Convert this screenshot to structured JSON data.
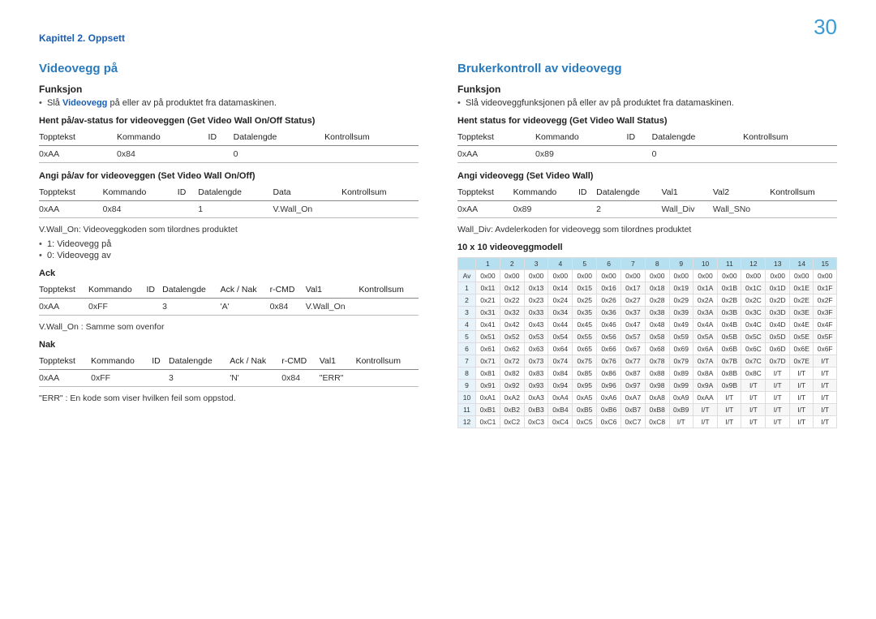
{
  "page": {
    "chapter": "Kapittel 2. Oppsett",
    "number": "30"
  },
  "left": {
    "title": "Videovegg på",
    "funksjon_label": "Funksjon",
    "funksjon_bullet_pre": "Slå ",
    "funksjon_bullet_emph": "Videovegg",
    "funksjon_bullet_post": " på eller av på produktet fra datamaskinen.",
    "section_get": "Hent på/av-status for videoveggen (Get Video Wall On/Off Status)",
    "t1": {
      "h": [
        "Topptekst",
        "Kommando",
        "ID",
        "Datalengde",
        "Kontrollsum"
      ],
      "r": [
        "0xAA",
        "0x84",
        "",
        "0",
        ""
      ]
    },
    "section_set": "Angi på/av for videoveggen (Set Video Wall On/Off)",
    "t2": {
      "h": [
        "Topptekst",
        "Kommando",
        "ID",
        "Datalengde",
        "Data",
        "Kontrollsum"
      ],
      "r": [
        "0xAA",
        "0x84",
        "",
        "1",
        "V.Wall_On",
        ""
      ]
    },
    "note1": "V.Wall_On: Videoveggkoden som tilordnes produktet",
    "note_bul1": "1: Videovegg på",
    "note_bul2": "0: Videovegg av",
    "ack_label": "Ack",
    "t3": {
      "h": [
        "Topptekst",
        "Kommando",
        "ID",
        "Datalengde",
        "Ack / Nak",
        "r-CMD",
        "Val1",
        "Kontrollsum"
      ],
      "r": [
        "0xAA",
        "0xFF",
        "",
        "3",
        "'A'",
        "0x84",
        "V.Wall_On",
        ""
      ]
    },
    "ack_note": "V.Wall_On : Samme som ovenfor",
    "nak_label": "Nak",
    "t4": {
      "h": [
        "Topptekst",
        "Kommando",
        "ID",
        "Datalengde",
        "Ack / Nak",
        "r-CMD",
        "Val1",
        "Kontrollsum"
      ],
      "r": [
        "0xAA",
        "0xFF",
        "",
        "3",
        "'N'",
        "0x84",
        "\"ERR\"",
        ""
      ]
    },
    "err_note": "\"ERR\" : En kode som viser hvilken feil som oppstod."
  },
  "right": {
    "title": "Brukerkontroll av videovegg",
    "funksjon_label": "Funksjon",
    "funksjon_bullet": "Slå videoveggfunksjonen på eller av på produktet fra datamaskinen.",
    "section_get": "Hent status for videovegg (Get Video Wall Status)",
    "t1": {
      "h": [
        "Topptekst",
        "Kommando",
        "ID",
        "Datalengde",
        "Kontrollsum"
      ],
      "r": [
        "0xAA",
        "0x89",
        "",
        "0",
        ""
      ]
    },
    "section_set": "Angi videovegg (Set Video Wall)",
    "t2": {
      "h": [
        "Topptekst",
        "Kommando",
        "ID",
        "Datalengde",
        "Val1",
        "Val2",
        "Kontrollsum"
      ],
      "r": [
        "0xAA",
        "0x89",
        "",
        "2",
        "Wall_Div",
        "Wall_SNo",
        ""
      ]
    },
    "note1": "Wall_Div: Avdelerkoden for videovegg som tilordnes produktet",
    "matrix_title": "10 x 10 videoveggmodell",
    "matrix": {
      "cols": [
        "1",
        "2",
        "3",
        "4",
        "5",
        "6",
        "7",
        "8",
        "9",
        "10",
        "11",
        "12",
        "13",
        "14",
        "15"
      ],
      "rows": [
        "Av",
        "1",
        "2",
        "3",
        "4",
        "5",
        "6",
        "7",
        "8",
        "9",
        "10",
        "11",
        "12"
      ],
      "cells": [
        [
          "0x00",
          "0x00",
          "0x00",
          "0x00",
          "0x00",
          "0x00",
          "0x00",
          "0x00",
          "0x00",
          "0x00",
          "0x00",
          "0x00",
          "0x00",
          "0x00",
          "0x00"
        ],
        [
          "0x11",
          "0x12",
          "0x13",
          "0x14",
          "0x15",
          "0x16",
          "0x17",
          "0x18",
          "0x19",
          "0x1A",
          "0x1B",
          "0x1C",
          "0x1D",
          "0x1E",
          "0x1F"
        ],
        [
          "0x21",
          "0x22",
          "0x23",
          "0x24",
          "0x25",
          "0x26",
          "0x27",
          "0x28",
          "0x29",
          "0x2A",
          "0x2B",
          "0x2C",
          "0x2D",
          "0x2E",
          "0x2F"
        ],
        [
          "0x31",
          "0x32",
          "0x33",
          "0x34",
          "0x35",
          "0x36",
          "0x37",
          "0x38",
          "0x39",
          "0x3A",
          "0x3B",
          "0x3C",
          "0x3D",
          "0x3E",
          "0x3F"
        ],
        [
          "0x41",
          "0x42",
          "0x43",
          "0x44",
          "0x45",
          "0x46",
          "0x47",
          "0x48",
          "0x49",
          "0x4A",
          "0x4B",
          "0x4C",
          "0x4D",
          "0x4E",
          "0x4F"
        ],
        [
          "0x51",
          "0x52",
          "0x53",
          "0x54",
          "0x55",
          "0x56",
          "0x57",
          "0x58",
          "0x59",
          "0x5A",
          "0x5B",
          "0x5C",
          "0x5D",
          "0x5E",
          "0x5F"
        ],
        [
          "0x61",
          "0x62",
          "0x63",
          "0x64",
          "0x65",
          "0x66",
          "0x67",
          "0x68",
          "0x69",
          "0x6A",
          "0x6B",
          "0x6C",
          "0x6D",
          "0x6E",
          "0x6F"
        ],
        [
          "0x71",
          "0x72",
          "0x73",
          "0x74",
          "0x75",
          "0x76",
          "0x77",
          "0x78",
          "0x79",
          "0x7A",
          "0x7B",
          "0x7C",
          "0x7D",
          "0x7E",
          "I/T"
        ],
        [
          "0x81",
          "0x82",
          "0x83",
          "0x84",
          "0x85",
          "0x86",
          "0x87",
          "0x88",
          "0x89",
          "0x8A",
          "0x8B",
          "0x8C",
          "I/T",
          "I/T",
          "I/T"
        ],
        [
          "0x91",
          "0x92",
          "0x93",
          "0x94",
          "0x95",
          "0x96",
          "0x97",
          "0x98",
          "0x99",
          "0x9A",
          "0x9B",
          "I/T",
          "I/T",
          "I/T",
          "I/T"
        ],
        [
          "0xA1",
          "0xA2",
          "0xA3",
          "0xA4",
          "0xA5",
          "0xA6",
          "0xA7",
          "0xA8",
          "0xA9",
          "0xAA",
          "I/T",
          "I/T",
          "I/T",
          "I/T",
          "I/T"
        ],
        [
          "0xB1",
          "0xB2",
          "0xB3",
          "0xB4",
          "0xB5",
          "0xB6",
          "0xB7",
          "0xB8",
          "0xB9",
          "I/T",
          "I/T",
          "I/T",
          "I/T",
          "I/T",
          "I/T"
        ],
        [
          "0xC1",
          "0xC2",
          "0xC3",
          "0xC4",
          "0xC5",
          "0xC6",
          "0xC7",
          "0xC8",
          "I/T",
          "I/T",
          "I/T",
          "I/T",
          "I/T",
          "I/T",
          "I/T"
        ]
      ]
    }
  }
}
